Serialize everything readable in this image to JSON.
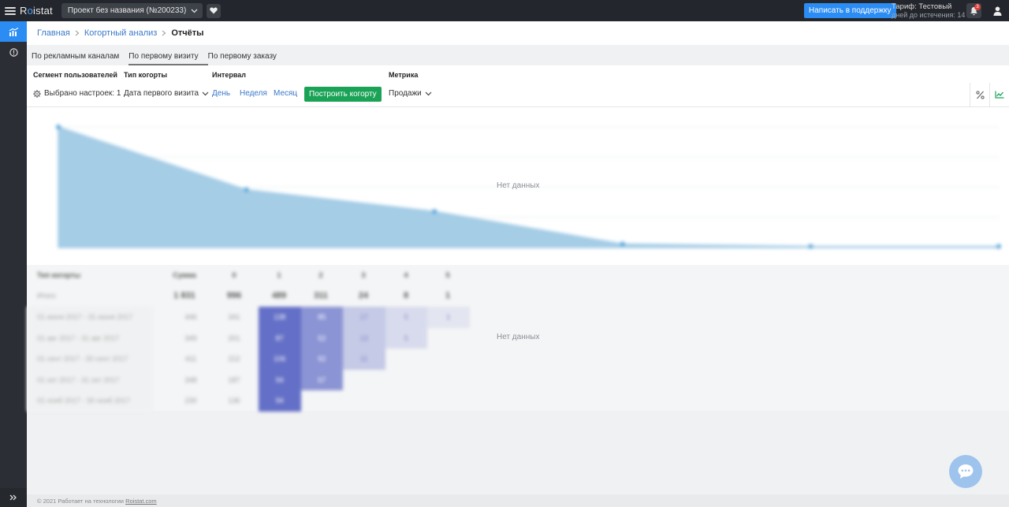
{
  "app": {
    "logo_prefix": "R",
    "logo_accent": "o",
    "logo_suffix": "istat",
    "project_name": "Проект без названия (№200233)",
    "support_button": "Написать в поддержку",
    "tariff_title": "Тариф: Тестовый",
    "tariff_sub": "дней до истечения: 14",
    "notifications_count": "3",
    "accent_color": "#2b8cf3",
    "green_color": "#1aa356"
  },
  "breadcrumbs": {
    "home": "Главная",
    "section": "Когортный анализ",
    "current": "Отчёты"
  },
  "tabs": [
    {
      "label": "По рекламным каналам"
    },
    {
      "label": "По первому визиту"
    },
    {
      "label": "По первому заказу"
    }
  ],
  "filters": {
    "segment_label": "Сегмент пользователей",
    "segment_value": "Выбрано настроек: 1",
    "cohort_type_label": "Тип когорты",
    "cohort_type_value": "Дата первого визита",
    "interval_label": "Интервал",
    "interval_day": "День",
    "interval_week": "Неделя",
    "interval_month": "Месяц",
    "build_button": "Построить когорту",
    "metric_label": "Метрика",
    "metric_value": "Продажи"
  },
  "chart": {
    "no_data": "Нет данных"
  },
  "chart_data": {
    "type": "area",
    "x": [
      0,
      1,
      2,
      3,
      4,
      5
    ],
    "values": [
      100,
      48,
      30,
      3,
      1,
      1
    ]
  },
  "table": {
    "no_data": "Нет данных",
    "header_cohort": "Тип когорты",
    "header_total": "Сумма",
    "periods": [
      "0",
      "1",
      "2",
      "3",
      "4",
      "5"
    ],
    "total_row": {
      "label": "Итого",
      "sum": "1 831",
      "values": [
        "996",
        "489",
        "311",
        "24",
        "8",
        "1"
      ]
    },
    "rows": [
      {
        "label": "01 июня 2017 - 31 июня 2017",
        "sum": "446",
        "first": "341",
        "cells": [
          "138",
          "85",
          "17",
          "5",
          "1"
        ]
      },
      {
        "label": "01 авг 2017 - 31 авг 2017",
        "sum": "349",
        "first": "201",
        "cells": [
          "87",
          "52",
          "13",
          "5"
        ]
      },
      {
        "label": "01 сент 2017 - 30 сент 2017",
        "sum": "411",
        "first": "212",
        "cells": [
          "106",
          "92",
          "11"
        ]
      },
      {
        "label": "01 окт 2017 - 31 окт 2017",
        "sum": "348",
        "first": "187",
        "cells": [
          "94",
          "67"
        ]
      },
      {
        "label": "01 нояб 2017 - 30 нояб 2017",
        "sum": "230",
        "first": "136",
        "cells": [
          "94"
        ]
      }
    ]
  },
  "footer": {
    "text": "© 2021 Работает на технологии",
    "link": "Roistat.com"
  }
}
